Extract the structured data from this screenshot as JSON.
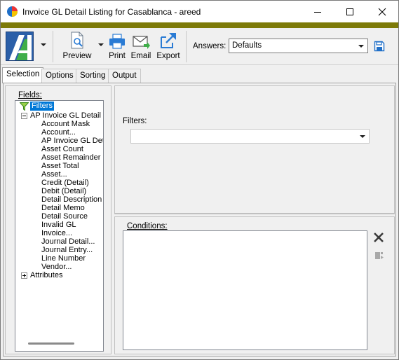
{
  "window": {
    "title": "Invoice GL Detail Listing for Casablanca - areed",
    "accent_color": "#7d7a08"
  },
  "toolbar": {
    "preview_label": "Preview",
    "print_label": "Print",
    "email_label": "Email",
    "export_label": "Export",
    "answers_label": "Answers:",
    "answers_value": "Defaults"
  },
  "tabs": [
    {
      "label": "Selection",
      "active": true
    },
    {
      "label": "Options"
    },
    {
      "label": "Sorting"
    },
    {
      "label": "Output"
    }
  ],
  "selection": {
    "fields_label": "Fields:",
    "tree": {
      "root_label": "Filters",
      "groups": [
        {
          "label": "AP Invoice GL Detail",
          "expanded": true,
          "items": [
            "Account Mask",
            "Account...",
            "AP Invoice GL Deta",
            "Asset Count",
            "Asset Remainder",
            "Asset Total",
            "Asset...",
            "Credit (Detail)",
            "Debit (Detail)",
            "Detail Description",
            "Detail Memo",
            "Detail Source",
            "Invalid GL",
            "Invoice...",
            "Journal Detail...",
            "Journal Entry...",
            "Line Number",
            "Vendor..."
          ]
        },
        {
          "label": "Attributes",
          "expanded": false
        }
      ]
    },
    "filters_label": "Filters:",
    "filters_value": "",
    "conditions_label": "Conditions:"
  }
}
